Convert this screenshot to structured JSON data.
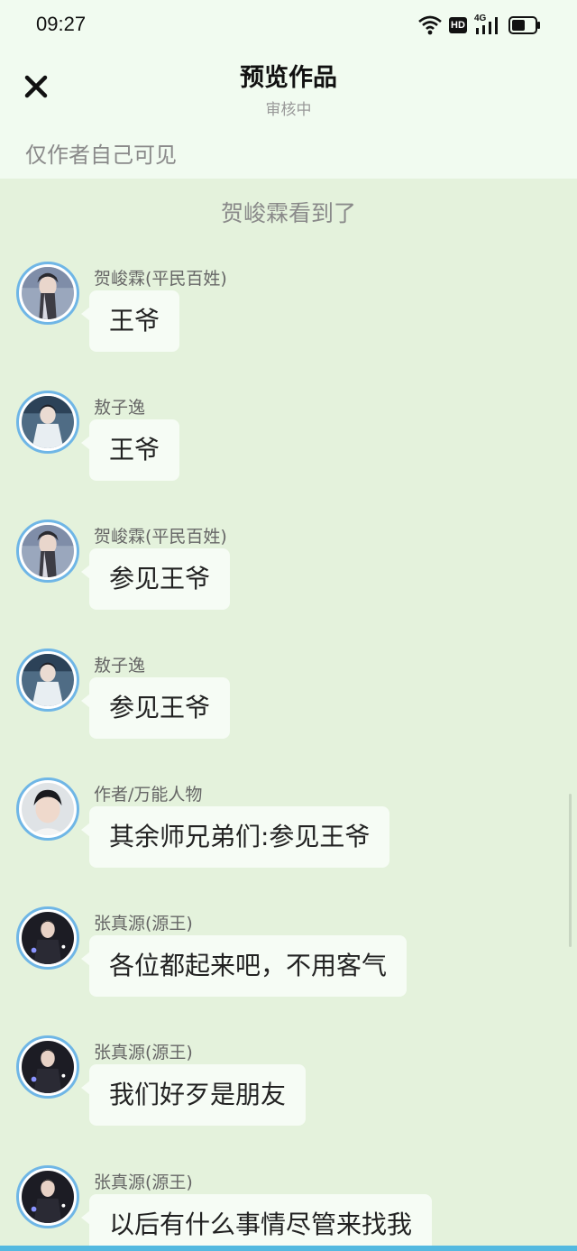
{
  "status_bar": {
    "time": "09:27",
    "hd_label": "HD",
    "network_label": "4G",
    "icons": [
      "wifi-icon",
      "hd-icon",
      "signal-4g-icon",
      "battery-icon"
    ]
  },
  "header": {
    "title": "预览作品",
    "subtitle": "审核中",
    "close_icon": "close-icon",
    "visibility_note": "仅作者自己可见"
  },
  "chat": {
    "seen_note": "贺峻霖看到了",
    "messages": [
      {
        "sender": "贺峻霖(平民百姓)",
        "text": "王爷",
        "avatar": "avatar-hejunlin"
      },
      {
        "sender": "敖子逸",
        "text": "王爷",
        "avatar": "avatar-aoziyi"
      },
      {
        "sender": "贺峻霖(平民百姓)",
        "text": "参见王爷",
        "avatar": "avatar-hejunlin"
      },
      {
        "sender": "敖子逸",
        "text": "参见王爷",
        "avatar": "avatar-aoziyi"
      },
      {
        "sender": "作者/万能人物",
        "text": "其余师兄弟们:参见王爷",
        "avatar": "avatar-author"
      },
      {
        "sender": "张真源(源王)",
        "text": "各位都起来吧，不用客气",
        "avatar": "avatar-zhangzhenyuan"
      },
      {
        "sender": "张真源(源王)",
        "text": "我们好歹是朋友",
        "avatar": "avatar-zhangzhenyuan"
      },
      {
        "sender": "张真源(源王)",
        "text": "以后有什么事情尽管来找我",
        "avatar": "avatar-zhangzhenyuan"
      }
    ]
  },
  "colors": {
    "top_background": "#f1fbf0",
    "chat_background": "#e4f2dc",
    "bubble": "#f6fcf5",
    "avatar_ring": "#6fb6e6",
    "home_indicator": "#53b9e0"
  }
}
